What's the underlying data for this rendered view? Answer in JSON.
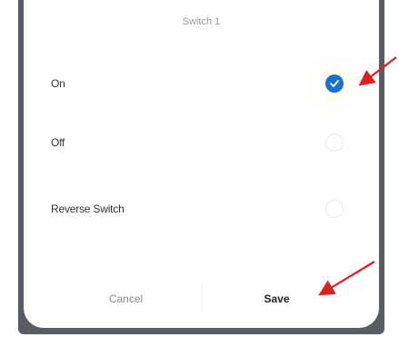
{
  "dialog": {
    "title": "Switch 1",
    "options": [
      {
        "label": "On",
        "selected": true
      },
      {
        "label": "Off",
        "selected": false
      },
      {
        "label": "Reverse Switch",
        "selected": false
      }
    ],
    "cancel_label": "Cancel",
    "save_label": "Save"
  },
  "colors": {
    "accent": "#1a6fd0",
    "backdrop": "#585c63",
    "annotation_arrow": "#e0201c"
  },
  "icons": {
    "checkmark": "check-icon",
    "annotation": "red-arrow-annotation"
  }
}
